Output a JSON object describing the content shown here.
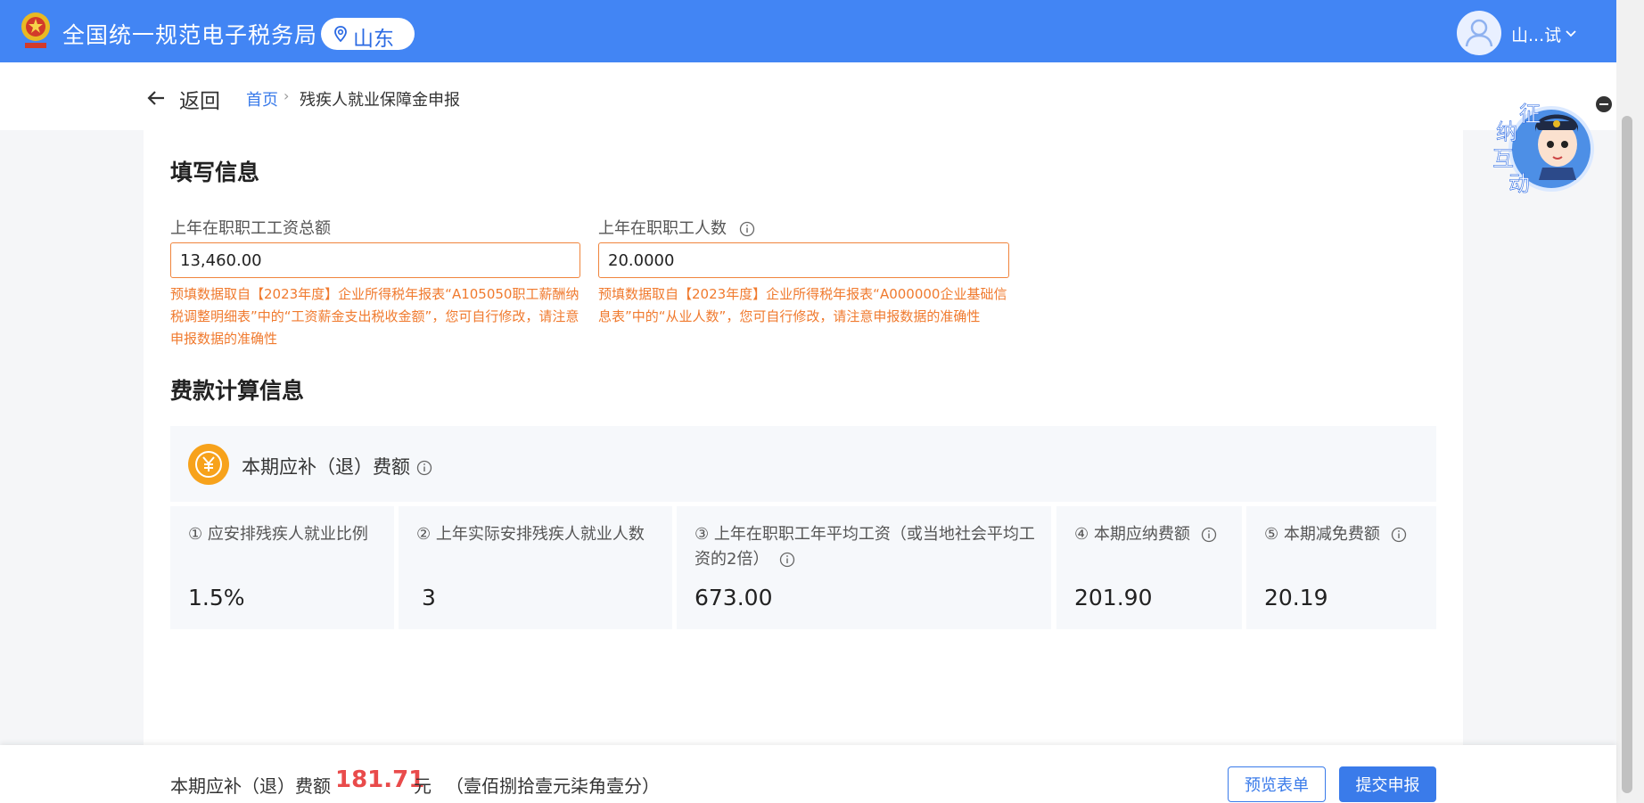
{
  "header": {
    "site_title": "全国统一规范电子税务局",
    "region": "山东",
    "user_name": "山...试"
  },
  "breadcrumb": {
    "back_label": "返回",
    "home": "首页",
    "separator": "›",
    "current": "残疾人就业保障金申报"
  },
  "fill_section": {
    "title": "填写信息",
    "fields": [
      {
        "label": "上年在职职工工资总额",
        "value": "13,460.00",
        "hint": "预填数据取自【2023年度】企业所得税年报表“A105050职工薪酬纳税调整明细表”中的“工资薪金支出税收金额”，您可自行修改，请注意申报数据的准确性"
      },
      {
        "label": "上年在职职工人数",
        "value": "20.0000",
        "hint": "预填数据取自【2023年度】企业所得税年报表“A000000企业基础信息表”中的“从业人数”，您可自行修改，请注意申报数据的准确性"
      }
    ]
  },
  "calc_section": {
    "title": "费款计算信息",
    "fee_label": "本期应补（退）费额",
    "metrics": [
      {
        "label": "① 应安排残疾人就业比例",
        "value": "1.5%"
      },
      {
        "label": "② 上年实际安排残疾人就业人数",
        "value": "3"
      },
      {
        "label": "③ 上年在职职工年平均工资（或当地社会平均工资的2倍）",
        "value": "673.00"
      },
      {
        "label": "④ 本期应纳费额",
        "value": "201.90"
      },
      {
        "label": "⑤ 本期减免费额",
        "value": "20.19"
      }
    ]
  },
  "mascot": {
    "text": [
      "征",
      "纳",
      "互",
      "动"
    ]
  },
  "footer": {
    "label": "本期应补（退）费额",
    "amount": "181.71",
    "unit": "元",
    "amount_in_words": "（壹佰捌拾壹元柒角壹分）",
    "preview_button": "预览表单",
    "submit_button": "提交申报"
  },
  "colors": {
    "header_bg": "#4285f4",
    "accent_blue": "#3a7bea",
    "warning_orange": "#f07a2e",
    "amount_red": "#e94b4b",
    "coin_orange": "#f7a21b"
  },
  "icons": [
    "tax-emblem-icon",
    "location-pin-icon",
    "user-avatar-icon",
    "chevron-down-icon",
    "back-arrow-icon",
    "info-icon",
    "yuan-coin-icon",
    "mascot-icon",
    "close-icon"
  ]
}
